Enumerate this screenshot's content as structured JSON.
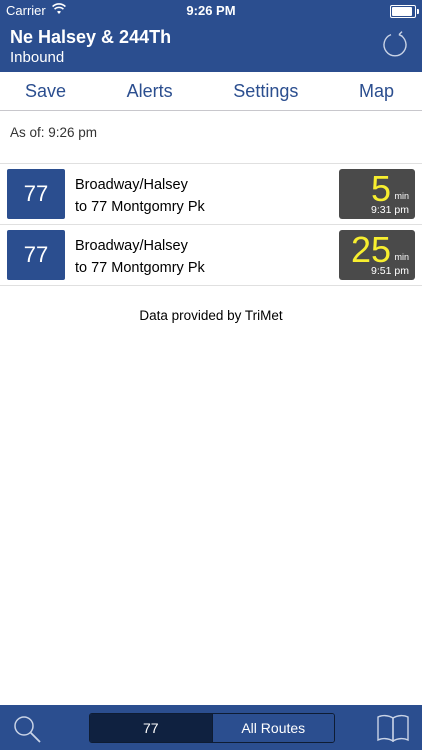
{
  "status_bar": {
    "carrier": "Carrier",
    "time": "9:26 PM"
  },
  "header": {
    "title": "Ne Halsey & 244Th",
    "direction": "Inbound"
  },
  "menu": {
    "save": "Save",
    "alerts": "Alerts",
    "settings": "Settings",
    "map": "Map"
  },
  "as_of": "As of: 9:26 pm",
  "arrivals": [
    {
      "route": "77",
      "line1": "Broadway/Halsey",
      "line2": "to 77 Montgomry Pk",
      "minutes": "5",
      "unit": "min",
      "time": "9:31 pm"
    },
    {
      "route": "77",
      "line1": "Broadway/Halsey",
      "line2": "to 77 Montgomry Pk",
      "minutes": "25",
      "unit": "min",
      "time": "9:51 pm"
    }
  ],
  "attribution": "Data provided by TriMet",
  "tabbar": {
    "segment_selected": "77",
    "segment_other": "All Routes"
  },
  "colors": {
    "primary": "#2b4e8f",
    "eta_bg": "#4a4a4a",
    "eta_minutes": "#f7ee2f",
    "segment_active": "#0f2140"
  },
  "icons": {
    "refresh": "refresh-icon",
    "search": "search-icon",
    "book": "book-icon",
    "wifi": "wifi-icon",
    "battery": "battery-icon"
  }
}
